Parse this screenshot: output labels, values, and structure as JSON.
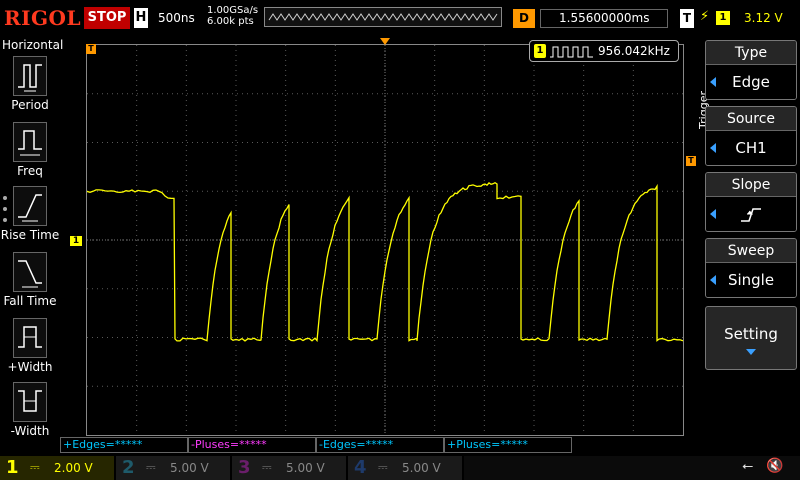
{
  "header": {
    "logo": "RIGOL",
    "run_state": "STOP",
    "h_label": "H",
    "timebase": "500ns",
    "sample_rate": "1.00GSa/s",
    "mem_points": "6.00k pts",
    "d_label": "D",
    "delay": "1.55600000ms",
    "t_label": "T",
    "trigger_channel": "1",
    "trigger_level": "3.12 V"
  },
  "left_panel": {
    "title": "Horizontal",
    "items": [
      {
        "label": "Period",
        "icon": "period-icon"
      },
      {
        "label": "Freq",
        "icon": "freq-icon"
      },
      {
        "label": "Rise Time",
        "icon": "rise-time-icon"
      },
      {
        "label": "Fall Time",
        "icon": "fall-time-icon"
      },
      {
        "label": "+Width",
        "icon": "pos-width-icon"
      },
      {
        "label": "-Width",
        "icon": "neg-width-icon"
      }
    ]
  },
  "counter": {
    "channel": "1",
    "value": "956.042kHz"
  },
  "right_menu": {
    "title": "Trigger",
    "type": {
      "title": "Type",
      "value": "Edge"
    },
    "source": {
      "title": "Source",
      "value": "CH1"
    },
    "slope": {
      "title": "Slope",
      "icon": "rising-edge-icon"
    },
    "sweep": {
      "title": "Sweep",
      "value": "Single"
    },
    "setting": {
      "title": "Setting"
    }
  },
  "measure_bar": [
    {
      "label": "+Edges=*****",
      "color": "#00c8ff"
    },
    {
      "label": "-Pluses=*****",
      "color": "#ff3cff"
    },
    {
      "label": "-Edges=*****",
      "color": "#00c8ff"
    },
    {
      "label": "+Pluses=*****",
      "color": "#00c8ff"
    }
  ],
  "channels": [
    {
      "n": "1",
      "scale": "2.00 V",
      "color": "#ffff00",
      "active": true
    },
    {
      "n": "2",
      "scale": "5.00 V",
      "color": "#00c8ff",
      "active": false
    },
    {
      "n": "3",
      "scale": "5.00 V",
      "color": "#ff3cff",
      "active": false
    },
    {
      "n": "4",
      "scale": "5.00 V",
      "color": "#3a7fff",
      "active": false
    }
  ],
  "markers": {
    "ch1_ground": "1",
    "trigger_marker": "T"
  },
  "waveform": {
    "color": "#ffff00",
    "high_level_div": 1.0,
    "low_level_div": -2.0
  }
}
